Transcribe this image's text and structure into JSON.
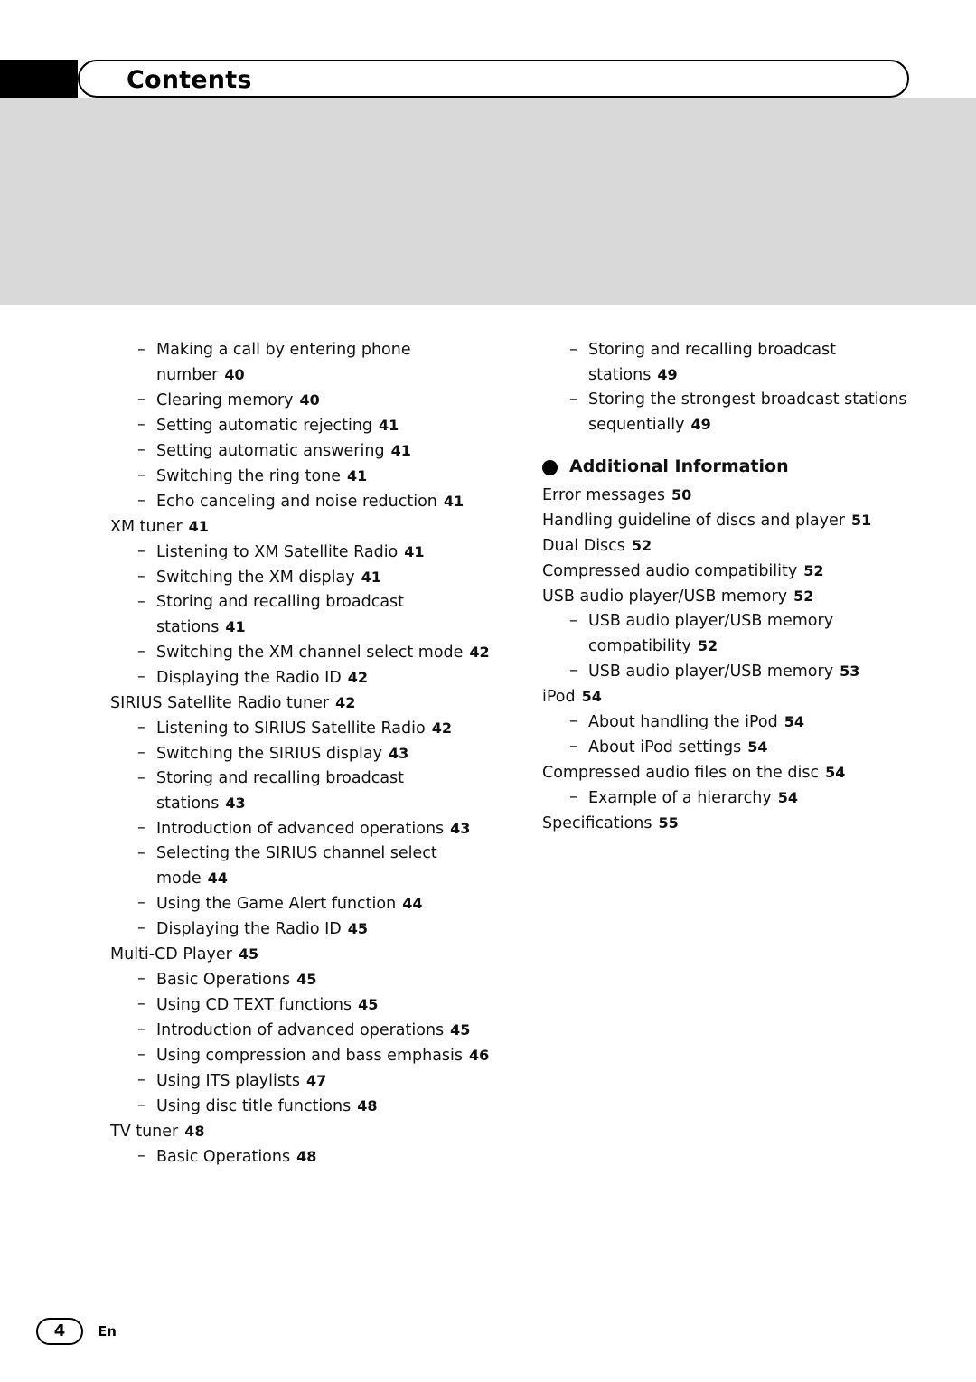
{
  "header": {
    "title": "Contents"
  },
  "footer": {
    "page_number": "4",
    "language": "En"
  },
  "left_column": [
    {
      "level": 2,
      "text": "Making a call by entering phone number",
      "page": "40"
    },
    {
      "level": 2,
      "text": "Clearing memory",
      "page": "40"
    },
    {
      "level": 2,
      "text": "Setting automatic rejecting",
      "page": "41"
    },
    {
      "level": 2,
      "text": "Setting automatic answering",
      "page": "41"
    },
    {
      "level": 2,
      "text": "Switching the ring tone",
      "page": "41"
    },
    {
      "level": 2,
      "text": "Echo canceling and noise reduction",
      "page": "41"
    },
    {
      "level": 1,
      "text": "XM tuner",
      "page": "41"
    },
    {
      "level": 2,
      "text": "Listening to XM Satellite Radio",
      "page": "41"
    },
    {
      "level": 2,
      "text": "Switching the XM display",
      "page": "41"
    },
    {
      "level": 2,
      "text": "Storing and recalling broadcast stations",
      "page": "41"
    },
    {
      "level": 2,
      "text": "Switching the XM channel select mode",
      "page": "42"
    },
    {
      "level": 2,
      "text": "Displaying the Radio ID",
      "page": "42"
    },
    {
      "level": 1,
      "text": "SIRIUS Satellite Radio tuner",
      "page": "42"
    },
    {
      "level": 2,
      "text": "Listening to SIRIUS Satellite Radio",
      "page": "42"
    },
    {
      "level": 2,
      "text": "Switching the SIRIUS display",
      "page": "43"
    },
    {
      "level": 2,
      "text": "Storing and recalling broadcast stations",
      "page": "43"
    },
    {
      "level": 2,
      "text": "Introduction of advanced operations",
      "page": "43"
    },
    {
      "level": 2,
      "text": "Selecting the SIRIUS channel select mode",
      "page": "44"
    },
    {
      "level": 2,
      "text": "Using the Game Alert function",
      "page": "44"
    },
    {
      "level": 2,
      "text": "Displaying the Radio ID",
      "page": "45"
    },
    {
      "level": 1,
      "text": "Multi-CD Player",
      "page": "45"
    },
    {
      "level": 2,
      "text": "Basic Operations",
      "page": "45"
    },
    {
      "level": 2,
      "text": "Using CD TEXT functions",
      "page": "45"
    },
    {
      "level": 2,
      "text": "Introduction of advanced operations",
      "page": "45"
    },
    {
      "level": 2,
      "text": "Using compression and bass emphasis",
      "page": "46"
    },
    {
      "level": 2,
      "text": "Using ITS playlists",
      "page": "47"
    },
    {
      "level": 2,
      "text": "Using disc title functions",
      "page": "48"
    },
    {
      "level": 1,
      "text": "TV tuner",
      "page": "48"
    },
    {
      "level": 2,
      "text": "Basic Operations",
      "page": "48"
    }
  ],
  "right_column_top": [
    {
      "level": 2,
      "text": "Storing and recalling broadcast stations",
      "page": "49"
    },
    {
      "level": 2,
      "text": "Storing the strongest broadcast stations sequentially",
      "page": "49"
    }
  ],
  "right_section": {
    "heading": "Additional Information",
    "items": [
      {
        "level": 1,
        "text": "Error messages",
        "page": "50"
      },
      {
        "level": 1,
        "text": "Handling guideline of discs and player",
        "page": "51"
      },
      {
        "level": 1,
        "text": "Dual Discs",
        "page": "52"
      },
      {
        "level": 1,
        "text": "Compressed audio compatibility",
        "page": "52"
      },
      {
        "level": 1,
        "text": "USB audio player/USB memory",
        "page": "52"
      },
      {
        "level": 2,
        "text": "USB audio player/USB memory compatibility",
        "page": "52"
      },
      {
        "level": 2,
        "text": "USB audio player/USB memory",
        "page": "53"
      },
      {
        "level": 1,
        "text": "iPod",
        "page": "54"
      },
      {
        "level": 2,
        "text": "About handling the iPod",
        "page": "54"
      },
      {
        "level": 2,
        "text": "About iPod settings",
        "page": "54"
      },
      {
        "level": 1,
        "text": "Compressed audio files on the disc",
        "page": "54"
      },
      {
        "level": 2,
        "text": "Example of a hierarchy",
        "page": "54"
      },
      {
        "level": 1,
        "text": "Specifications",
        "page": "55"
      }
    ]
  },
  "symbols": {
    "dash": "–"
  }
}
